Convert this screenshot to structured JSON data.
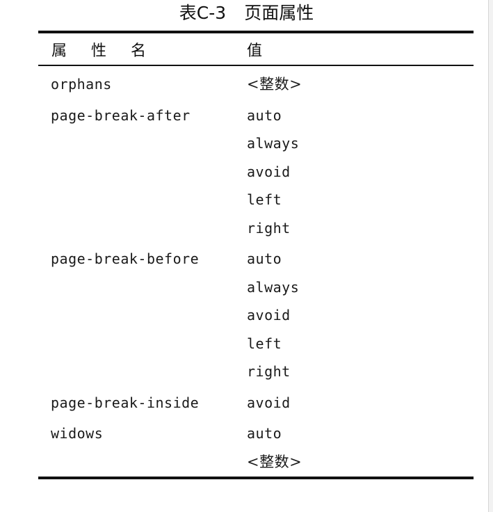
{
  "caption": {
    "label": "表C-3",
    "title": "页面属性"
  },
  "table": {
    "headers": {
      "name": "属 性 名",
      "value": "值"
    },
    "rows": [
      {
        "property": "orphans",
        "values": [
          "<整数>"
        ]
      },
      {
        "property": "page-break-after",
        "values": [
          "auto",
          "always",
          "avoid",
          "left",
          "right"
        ]
      },
      {
        "property": "page-break-before",
        "values": [
          "auto",
          "always",
          "avoid",
          "left",
          "right"
        ]
      },
      {
        "property": "page-break-inside",
        "values": [
          "avoid"
        ]
      },
      {
        "property": "widows",
        "values": [
          "auto",
          "<整数>"
        ]
      }
    ]
  }
}
